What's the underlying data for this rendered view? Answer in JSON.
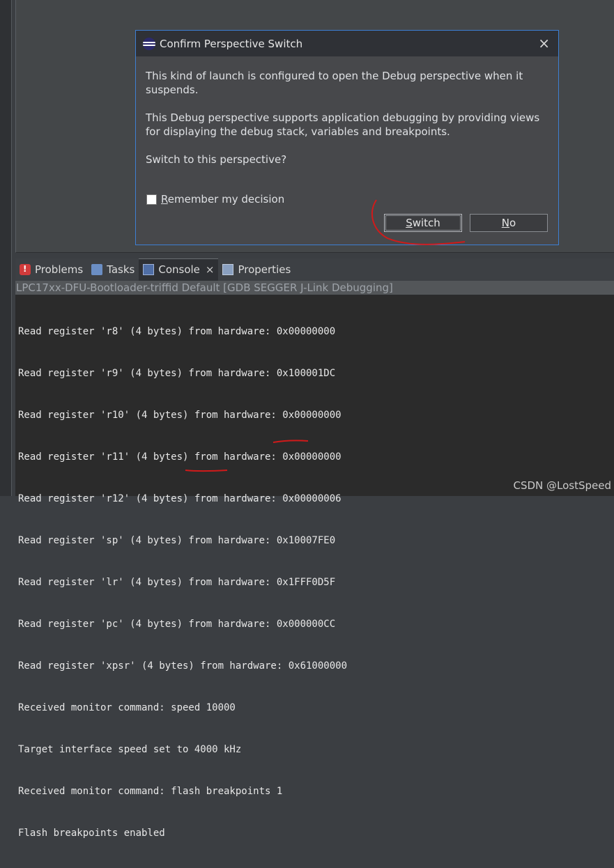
{
  "dialog": {
    "title": "Confirm Perspective Switch",
    "close_icon": "×",
    "message_1": "This kind of launch is configured to open the Debug perspective when it suspends.",
    "message_2": "This Debug perspective supports application debugging by providing views for displaying the debug stack, variables and breakpoints.",
    "message_3": "Switch to this perspective?",
    "remember_prefix": "R",
    "remember_rest": "emember my decision",
    "remember_checked": false,
    "switch_prefix": "S",
    "switch_rest": "witch",
    "no_prefix": "N",
    "no_rest": "o"
  },
  "views": {
    "tabs": [
      {
        "label": "Problems",
        "icon": "problems-icon"
      },
      {
        "label": "Tasks",
        "icon": "tasks-icon"
      },
      {
        "label": "Console",
        "icon": "console-icon",
        "active": true
      },
      {
        "label": "Properties",
        "icon": "properties-icon"
      }
    ],
    "tab_close": "×"
  },
  "console": {
    "title": "LPC17xx-DFU-Bootloader-triffid Default [GDB SEGGER J-Link Debugging]",
    "lines": [
      "Read register 'r8' (4 bytes) from hardware: 0x00000000",
      "Read register 'r9' (4 bytes) from hardware: 0x100001DC",
      "Read register 'r10' (4 bytes) from hardware: 0x00000000",
      "Read register 'r11' (4 bytes) from hardware: 0x00000000",
      "Read register 'r12' (4 bytes) from hardware: 0x00000006",
      "Read register 'sp' (4 bytes) from hardware: 0x10007FE0",
      "Read register 'lr' (4 bytes) from hardware: 0x1FFF0D5F",
      "Read register 'pc' (4 bytes) from hardware: 0x000000CC",
      "Read register 'xpsr' (4 bytes) from hardware: 0x61000000",
      "Received monitor command: speed 10000",
      "Target interface speed set to 4000 kHz",
      "Received monitor command: flash breakpoints 1",
      "Flash breakpoints enabled"
    ]
  },
  "watermark": "CSDN @LostSpeed",
  "colors": {
    "accent_border": "#3d7fd3",
    "annotation_red": "#d11a1a"
  }
}
